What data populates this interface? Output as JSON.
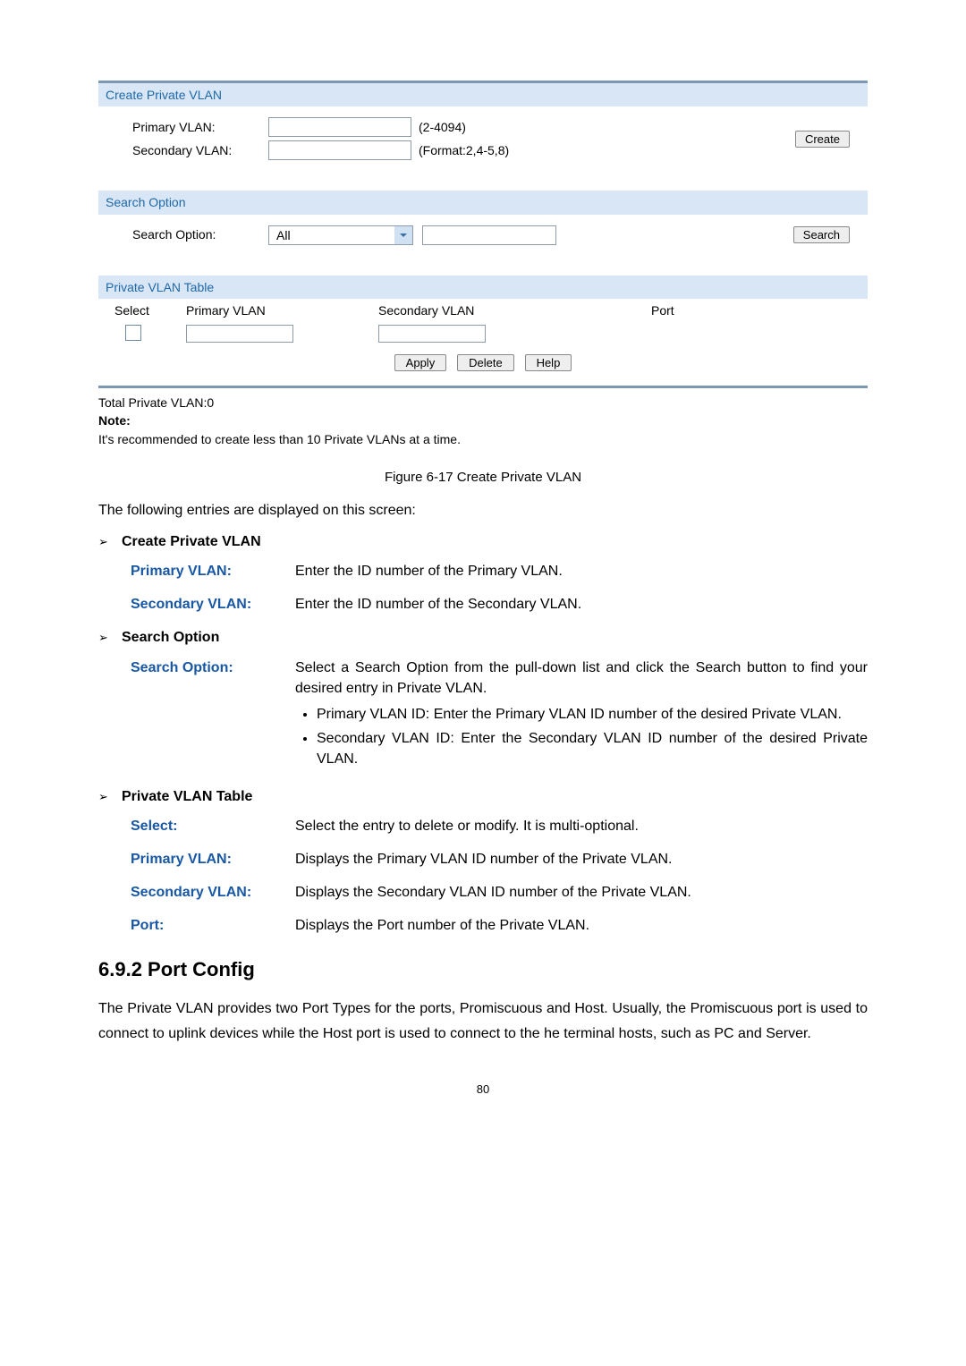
{
  "panel": {
    "create_header": "Create Private VLAN",
    "primary_label": "Primary VLAN:",
    "secondary_label": "Secondary VLAN:",
    "primary_hint": "(2-4094)",
    "secondary_hint": "(Format:2,4-5,8)",
    "create_btn": "Create",
    "search_header": "Search Option",
    "search_label": "Search Option:",
    "search_value": "All",
    "search_btn": "Search",
    "table_header": "Private VLAN Table",
    "col_select": "Select",
    "col_primary": "Primary VLAN",
    "col_secondary": "Secondary VLAN",
    "col_port": "Port",
    "btn_apply": "Apply",
    "btn_delete": "Delete",
    "btn_help": "Help",
    "total_line": "Total Private VLAN:0",
    "note_label": "Note:",
    "note_text": "It's recommended to create less than 10 Private VLANs at a time."
  },
  "caption": "Figure 6-17 Create Private VLAN",
  "intro": "The following entries are displayed on this screen:",
  "secA": {
    "title": "Create Private VLAN",
    "items": [
      {
        "term": "Primary VLAN:",
        "def": "Enter the ID number of the Primary VLAN."
      },
      {
        "term": "Secondary VLAN:",
        "def": "Enter the ID number of the Secondary VLAN."
      }
    ]
  },
  "secB": {
    "title": "Search Option",
    "term": "Search Option:",
    "def_intro": "Select a Search Option from the pull-down list and click the Search button to find your desired entry in Private VLAN.",
    "bullets": [
      "Primary VLAN ID: Enter the Primary VLAN ID number of the desired Private VLAN.",
      "Secondary VLAN ID: Enter the Secondary VLAN ID number of the desired Private VLAN."
    ]
  },
  "secC": {
    "title": "Private VLAN Table",
    "items": [
      {
        "term": "Select:",
        "def": "Select the entry to delete or modify. It is multi-optional."
      },
      {
        "term": "Primary VLAN:",
        "def": "Displays the Primary VLAN ID number of the Private VLAN."
      },
      {
        "term": "Secondary VLAN:",
        "def": "Displays the Secondary VLAN ID number of the Private VLAN."
      },
      {
        "term": "Port:",
        "def": "Displays the Port number of the Private VLAN."
      }
    ]
  },
  "subsection_title": "6.9.2 Port Config",
  "body_para": "The Private VLAN provides two Port Types for the ports, Promiscuous and Host. Usually, the Promiscuous port is used to connect to uplink devices while the Host port is used to connect to the he terminal hosts, such as PC and Server.",
  "page_number": "80"
}
